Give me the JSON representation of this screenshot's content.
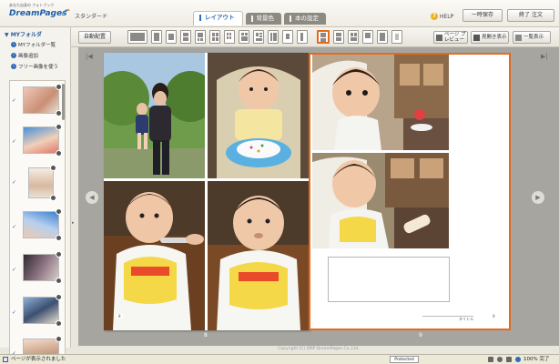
{
  "app": {
    "logo_sub": "あなた自身の フォトブック",
    "logo_main": "DreamPages",
    "mode_label": "スタンダード"
  },
  "tabs": [
    {
      "label": "レイアウト",
      "active": true
    },
    {
      "label": "背景色",
      "active": false
    },
    {
      "label": "本の設定",
      "active": false
    }
  ],
  "header": {
    "help_label": "HELP",
    "save_label": "一時保存",
    "finish_label": "終了 注文"
  },
  "toolbar": {
    "auto_layout_label": "自動配置",
    "page_preview_label": "ページ プレビュー",
    "spread_view_label": "見開き表示",
    "list_view_label": "一覧表示"
  },
  "sidebar": {
    "title": "MYフォルダ",
    "links": [
      {
        "label": "MYフォルダ一覧"
      },
      {
        "label": "画像追加"
      },
      {
        "label": "フリー画像を使う"
      }
    ],
    "thumbnails": 7
  },
  "workspace": {
    "left_page_number": "8",
    "right_page_number": "9",
    "left_page_marker": "8",
    "right_page_title": "タイトル",
    "right_page_marker": "9",
    "prev_arrow": "◀",
    "next_arrow": "▶",
    "first_mark": "|◀",
    "last_mark": "▶|"
  },
  "footer": {
    "copyright": "Copyright (C) DNP DreamPages Co.,Ltd."
  },
  "statusbar": {
    "text": "ページが表示されました",
    "box_label": "Protected",
    "zoom": "100% 完了"
  },
  "colors": {
    "accent": "#e46a1c",
    "brand": "#1f5ea8",
    "workspace_bg": "#a6a59f"
  }
}
